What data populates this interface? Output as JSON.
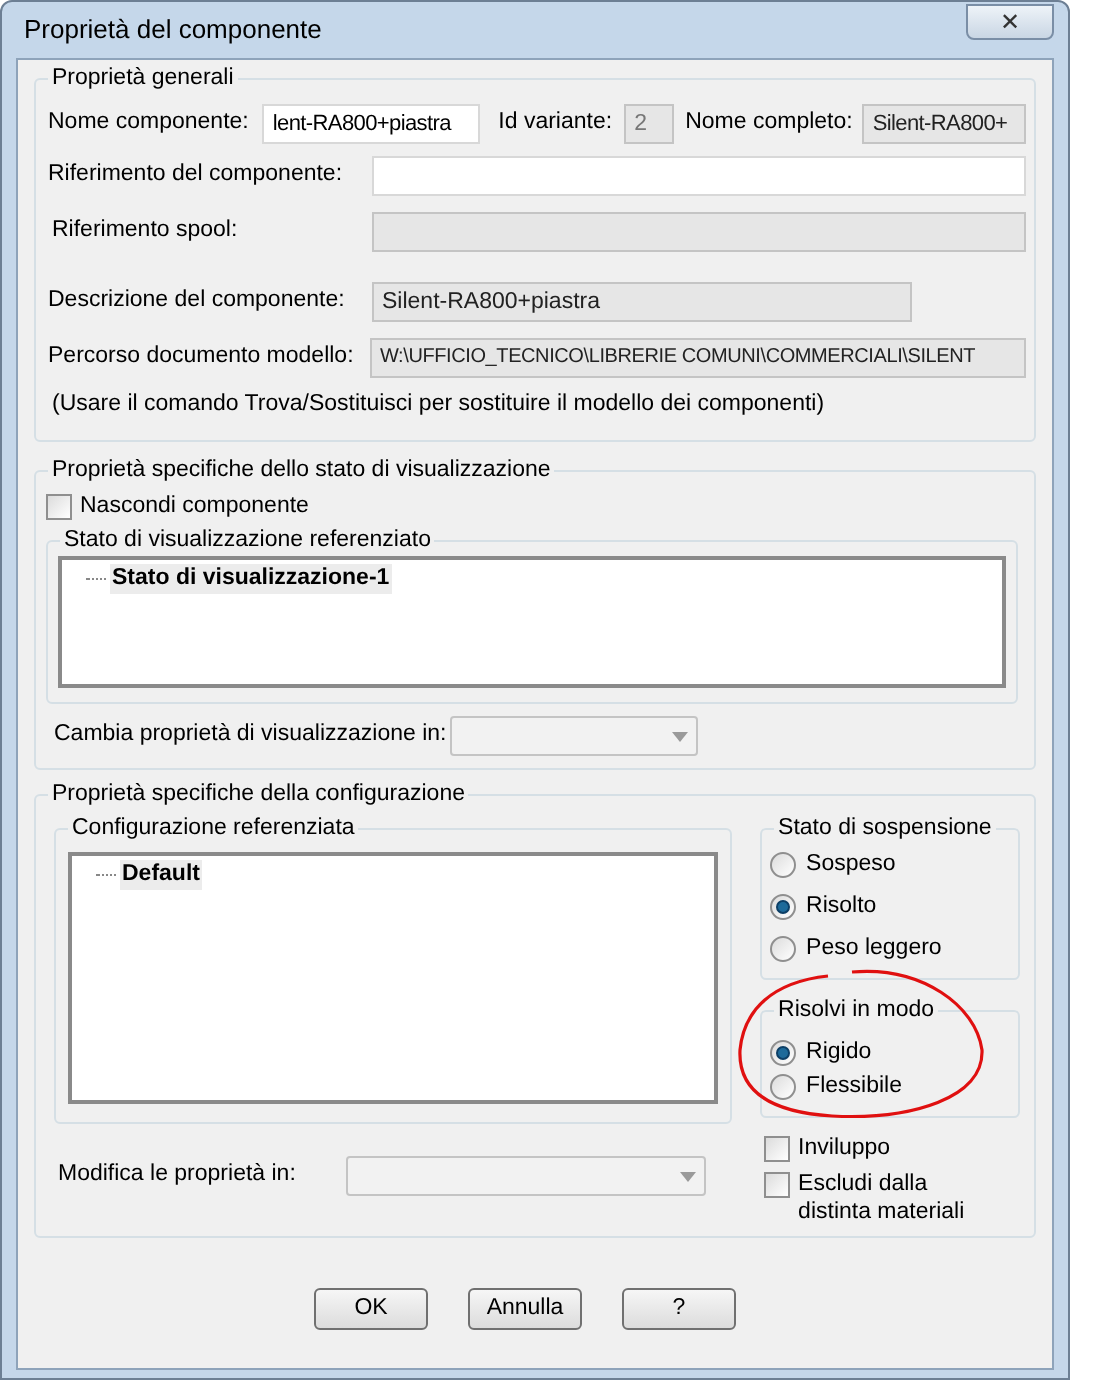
{
  "window": {
    "title": "Proprietà del componente",
    "close": "✕"
  },
  "general": {
    "title": "Proprietà generali",
    "name": {
      "label": "Nome componente:",
      "value": "lent-RA800+piastra"
    },
    "variant": {
      "label": "Id variante:",
      "value": "2"
    },
    "full_name": {
      "label": "Nome completo:",
      "value": "Silent-RA800+"
    },
    "fields": [
      {
        "label": "Riferimento del componente:",
        "disabled": false
      },
      {
        "label": "Riferimento spool:",
        "disabled": true
      }
    ],
    "description": {
      "label": "Descrizione del componente:",
      "value": "Silent-RA800+piastra"
    },
    "path": {
      "label": "Percorso documento modello:",
      "value": "W:\\UFFICIO_TECNICO\\LIBRERIE COMUNI\\COMMERCIALI\\SILENT"
    },
    "note": "(Usare il comando Trova/Sostituisci per sostituire il modello dei componenti)"
  },
  "display": {
    "title": "Proprietà specifiche dello stato di visualizzazione",
    "hide": {
      "label": "Nascondi componente",
      "checked": false
    },
    "referenced": {
      "title": "Stato di visualizzazione referenziato",
      "items": [
        {
          "label": "Stato di visualizzazione-1",
          "selected": true
        }
      ]
    },
    "change_label": "Cambia proprietà di visualizzazione in:"
  },
  "configuration": {
    "title": "Proprietà specifiche della configurazione",
    "referenced": {
      "title": "Configurazione referenziata",
      "items": [
        {
          "label": "Default",
          "selected": true
        }
      ]
    },
    "suspension": {
      "title": "Stato di sospensione",
      "options": [
        {
          "label": "Sospeso",
          "selected": false
        },
        {
          "label": "Risolto",
          "selected": true
        },
        {
          "label": "Peso leggero",
          "selected": false
        }
      ]
    },
    "solve": {
      "title": "Risolvi in modo",
      "options": [
        {
          "label": "Rigido",
          "selected": true
        },
        {
          "label": "Flessibile",
          "selected": false
        }
      ]
    },
    "checkboxes": [
      {
        "label": "Inviluppo",
        "checked": false
      },
      {
        "label": "Escludi dalla distinta materiali",
        "checked": false
      }
    ],
    "modify_label": "Modifica le proprietà in:"
  },
  "buttons": [
    "OK",
    "Annulla",
    "?"
  ]
}
